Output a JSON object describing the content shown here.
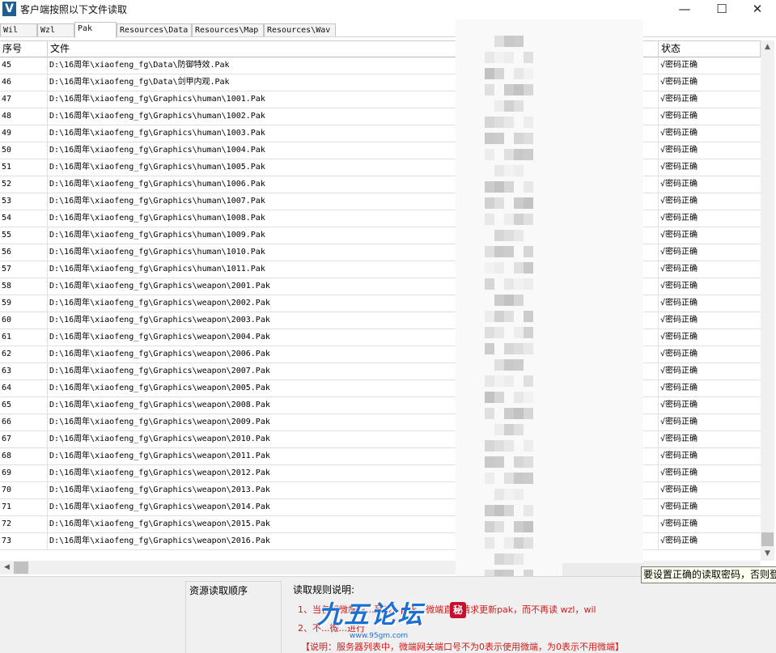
{
  "window": {
    "title": "客户端按照以下文件读取",
    "icon": "V",
    "minimize": "—",
    "maximize": "☐",
    "close": "✕"
  },
  "tabs": [
    "Wil",
    "Wzl",
    "Pak",
    "Resources\\Data",
    "Resources\\Map",
    "Resources\\Wav"
  ],
  "active_tab": "Pak",
  "table": {
    "columns": [
      "序号",
      "文件",
      "状态"
    ],
    "rows": [
      [
        "45",
        "D:\\16周年\\xiaofeng_fg\\Data\\防御特效.Pak",
        "√密码正确"
      ],
      [
        "46",
        "D:\\16周年\\xiaofeng_fg\\Data\\剑甲内观.Pak",
        "√密码正确"
      ],
      [
        "47",
        "D:\\16周年\\xiaofeng_fg\\Graphics\\human\\1001.Pak",
        "√密码正确"
      ],
      [
        "48",
        "D:\\16周年\\xiaofeng_fg\\Graphics\\human\\1002.Pak",
        "√密码正确"
      ],
      [
        "49",
        "D:\\16周年\\xiaofeng_fg\\Graphics\\human\\1003.Pak",
        "√密码正确"
      ],
      [
        "50",
        "D:\\16周年\\xiaofeng_fg\\Graphics\\human\\1004.Pak",
        "√密码正确"
      ],
      [
        "51",
        "D:\\16周年\\xiaofeng_fg\\Graphics\\human\\1005.Pak",
        "√密码正确"
      ],
      [
        "52",
        "D:\\16周年\\xiaofeng_fg\\Graphics\\human\\1006.Pak",
        "√密码正确"
      ],
      [
        "53",
        "D:\\16周年\\xiaofeng_fg\\Graphics\\human\\1007.Pak",
        "√密码正确"
      ],
      [
        "54",
        "D:\\16周年\\xiaofeng_fg\\Graphics\\human\\1008.Pak",
        "√密码正确"
      ],
      [
        "55",
        "D:\\16周年\\xiaofeng_fg\\Graphics\\human\\1009.Pak",
        "√密码正确"
      ],
      [
        "56",
        "D:\\16周年\\xiaofeng_fg\\Graphics\\human\\1010.Pak",
        "√密码正确"
      ],
      [
        "57",
        "D:\\16周年\\xiaofeng_fg\\Graphics\\human\\1011.Pak",
        "√密码正确"
      ],
      [
        "58",
        "D:\\16周年\\xiaofeng_fg\\Graphics\\weapon\\2001.Pak",
        "√密码正确"
      ],
      [
        "59",
        "D:\\16周年\\xiaofeng_fg\\Graphics\\weapon\\2002.Pak",
        "√密码正确"
      ],
      [
        "60",
        "D:\\16周年\\xiaofeng_fg\\Graphics\\weapon\\2003.Pak",
        "√密码正确"
      ],
      [
        "61",
        "D:\\16周年\\xiaofeng_fg\\Graphics\\weapon\\2004.Pak",
        "√密码正确"
      ],
      [
        "62",
        "D:\\16周年\\xiaofeng_fg\\Graphics\\weapon\\2006.Pak",
        "√密码正确"
      ],
      [
        "63",
        "D:\\16周年\\xiaofeng_fg\\Graphics\\weapon\\2007.Pak",
        "√密码正确"
      ],
      [
        "64",
        "D:\\16周年\\xiaofeng_fg\\Graphics\\weapon\\2005.Pak",
        "√密码正确"
      ],
      [
        "65",
        "D:\\16周年\\xiaofeng_fg\\Graphics\\weapon\\2008.Pak",
        "√密码正确"
      ],
      [
        "66",
        "D:\\16周年\\xiaofeng_fg\\Graphics\\weapon\\2009.Pak",
        "√密码正确"
      ],
      [
        "67",
        "D:\\16周年\\xiaofeng_fg\\Graphics\\weapon\\2010.Pak",
        "√密码正确"
      ],
      [
        "68",
        "D:\\16周年\\xiaofeng_fg\\Graphics\\weapon\\2011.Pak",
        "√密码正确"
      ],
      [
        "69",
        "D:\\16周年\\xiaofeng_fg\\Graphics\\weapon\\2012.Pak",
        "√密码正确"
      ],
      [
        "70",
        "D:\\16周年\\xiaofeng_fg\\Graphics\\weapon\\2013.Pak",
        "√密码正确"
      ],
      [
        "71",
        "D:\\16周年\\xiaofeng_fg\\Graphics\\weapon\\2014.Pak",
        "√密码正确"
      ],
      [
        "72",
        "D:\\16周年\\xiaofeng_fg\\Graphics\\weapon\\2015.Pak",
        "√密码正确"
      ],
      [
        "73",
        "D:\\16周年\\xiaofeng_fg\\Graphics\\weapon\\2016.Pak",
        "√密码正确"
      ]
    ]
  },
  "scrollbars": {
    "up_arrow": "▲",
    "down_arrow": "▼",
    "left_arrow": "◀"
  },
  "bottom": {
    "order_title": "资源读取顺序",
    "rules_title": "读取规则说明:",
    "rule1": "1、当仅用微端时...列表...pak，微端直接请求更新pak，而不再读 wzl，wil",
    "rule2": "2、不...微...进行",
    "note": "【说明：服务器列表中，微端网关端口号不为0表示使用微端，为0表示不用微端】"
  },
  "tooltip": "要设置正确的读取密码，否则登",
  "watermark": {
    "main": "九五论坛",
    "sub": "www.95gm.com",
    "seal": "秘"
  },
  "colors": {
    "rule_text": "#d21a1a",
    "watermark": "#1d6fd1",
    "app_icon": "#1d5f92"
  }
}
